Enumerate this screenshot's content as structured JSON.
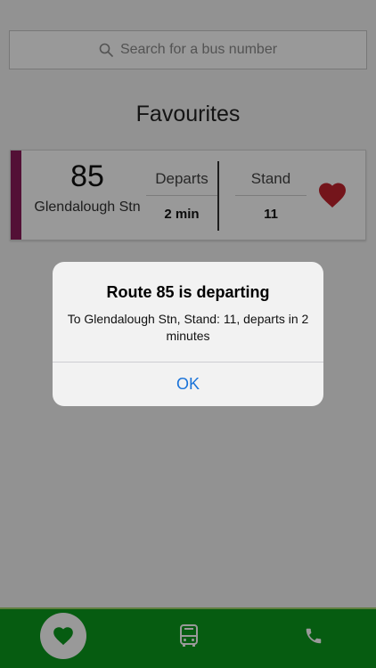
{
  "search": {
    "placeholder": "Search for a bus number",
    "icon": "search-icon"
  },
  "favourites": {
    "heading": "Favourites",
    "items": [
      {
        "route": "85",
        "destination": "Glendalough Stn",
        "departs_label": "Departs",
        "departs_value": "2 min",
        "stand_label": "Stand",
        "stand_value": "11",
        "accent_color": "#8a1c5a",
        "favourite_icon": "heart-icon",
        "heart_color": "#c2232d"
      }
    ]
  },
  "alert": {
    "title": "Route 85 is departing",
    "message": "To Glendalough Stn, Stand: 11, departs in 2 minutes",
    "ok_label": "OK"
  },
  "tabbar": {
    "color": "#0b9a1d",
    "tabs": [
      {
        "icon": "heart-icon",
        "active": true
      },
      {
        "icon": "bus-icon",
        "active": false
      },
      {
        "icon": "phone-icon",
        "active": false
      }
    ]
  }
}
